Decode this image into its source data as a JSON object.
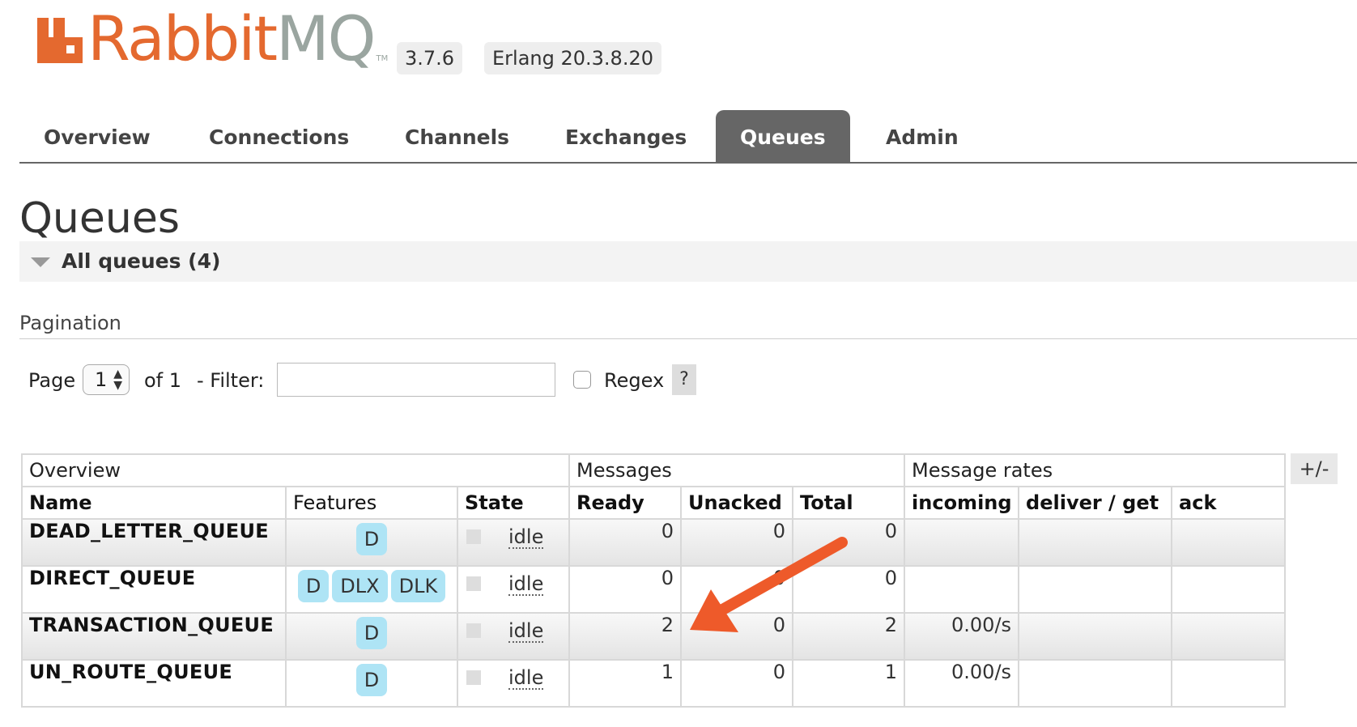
{
  "header": {
    "logo_text_rabbit": "Rabbit",
    "logo_text_mq": "MQ",
    "logo_tm": "TM",
    "version": "3.7.6",
    "erlang": "Erlang 20.3.8.20"
  },
  "nav": {
    "tabs": [
      {
        "label": "Overview",
        "active": false
      },
      {
        "label": "Connections",
        "active": false
      },
      {
        "label": "Channels",
        "active": false
      },
      {
        "label": "Exchanges",
        "active": false
      },
      {
        "label": "Queues",
        "active": true
      },
      {
        "label": "Admin",
        "active": false
      }
    ]
  },
  "page": {
    "title": "Queues",
    "section_title": "All queues (4)"
  },
  "pagination": {
    "label": "Pagination",
    "page_label": "Page",
    "page_value": "1",
    "of_label": "of 1",
    "filter_label": "- Filter:",
    "filter_value": "",
    "regex_label": "Regex",
    "regex_checked": false,
    "help": "?"
  },
  "table": {
    "toggle": "+/-",
    "groups": [
      "Overview",
      "Messages",
      "Message rates"
    ],
    "columns": [
      "Name",
      "Features",
      "State",
      "Ready",
      "Unacked",
      "Total",
      "incoming",
      "deliver / get",
      "ack"
    ],
    "rows": [
      {
        "name": "DEAD_LETTER_QUEUE",
        "features": [
          "D"
        ],
        "state": "idle",
        "ready": "0",
        "unacked": "0",
        "total": "0",
        "incoming": "",
        "deliver_get": "",
        "ack": ""
      },
      {
        "name": "DIRECT_QUEUE",
        "features": [
          "D",
          "DLX",
          "DLK"
        ],
        "state": "idle",
        "ready": "0",
        "unacked": "0",
        "total": "0",
        "incoming": "",
        "deliver_get": "",
        "ack": ""
      },
      {
        "name": "TRANSACTION_QUEUE",
        "features": [
          "D"
        ],
        "state": "idle",
        "ready": "2",
        "unacked": "0",
        "total": "2",
        "incoming": "0.00/s",
        "deliver_get": "",
        "ack": ""
      },
      {
        "name": "UN_ROUTE_QUEUE",
        "features": [
          "D"
        ],
        "state": "idle",
        "ready": "1",
        "unacked": "0",
        "total": "1",
        "incoming": "0.00/s",
        "deliver_get": "",
        "ack": ""
      }
    ]
  },
  "colors": {
    "brand_orange": "#e4692f",
    "brand_grey": "#9aa5a0",
    "active_tab": "#666666",
    "feature_badge": "#aee4f5",
    "annotation_arrow": "#ee5a2a"
  }
}
